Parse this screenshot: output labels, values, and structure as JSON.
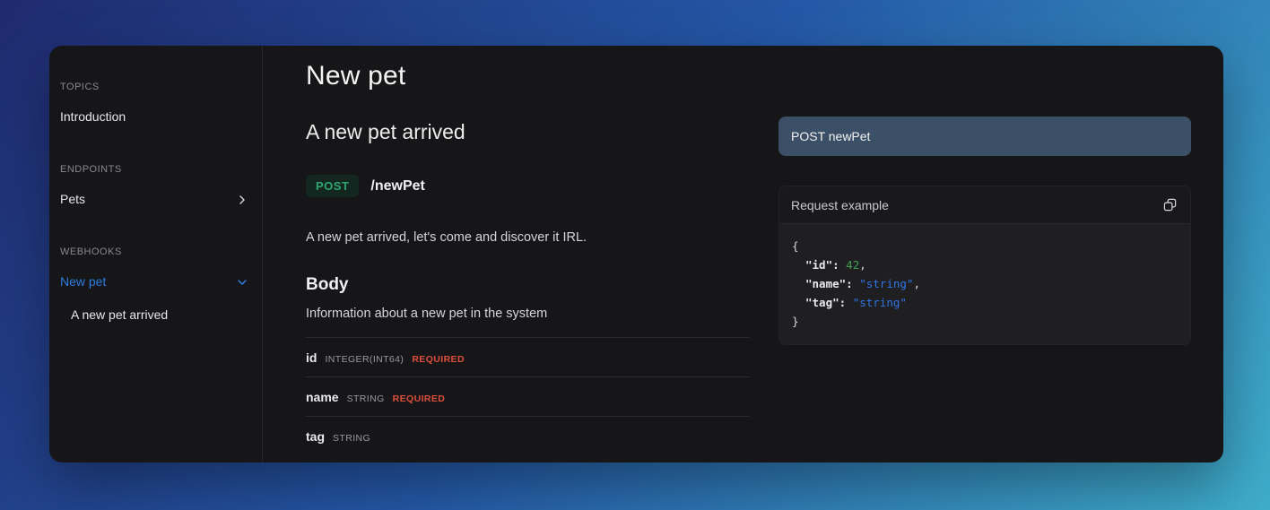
{
  "colors": {
    "background_top_left": "#1f2a6e",
    "background_bottom_right": "#3fadca",
    "card_background": "#161618",
    "accent_blue": "#2e7de0",
    "method_green": "#2fa572",
    "required_red": "#dd4f3c",
    "number_green": "#3f9e55",
    "string_blue": "#3273e8",
    "endpoint_bar_background": "#3b5066"
  },
  "sidebar": {
    "topics_heading": "TOPICS",
    "introduction": "Introduction",
    "endpoints_heading": "ENDPOINTS",
    "pets": "Pets",
    "webhooks_heading": "WEBHOOKS",
    "new_pet": "New pet",
    "a_new_pet_arrived": "A new pet arrived"
  },
  "main": {
    "page_title": "New pet",
    "operation_title": "A new pet arrived",
    "method": "POST",
    "path": "/newPet",
    "description": "A new pet arrived, let's come and discover it IRL.",
    "body_heading": "Body",
    "body_description": "Information about a new pet in the system",
    "fields": [
      {
        "name": "id",
        "type": "INTEGER(INT64)",
        "required": "REQUIRED"
      },
      {
        "name": "name",
        "type": "STRING",
        "required": "REQUIRED"
      },
      {
        "name": "tag",
        "type": "STRING"
      }
    ]
  },
  "example": {
    "endpoint_button": "POST newPet",
    "title": "Request example",
    "code": {
      "brace_open": "{",
      "brace_close": "}",
      "comma": ",",
      "id_key": "\"id\":",
      "id_value": "42",
      "name_key": "\"name\":",
      "name_value": "\"string\"",
      "tag_key": "\"tag\":",
      "tag_value": "\"string\""
    }
  }
}
